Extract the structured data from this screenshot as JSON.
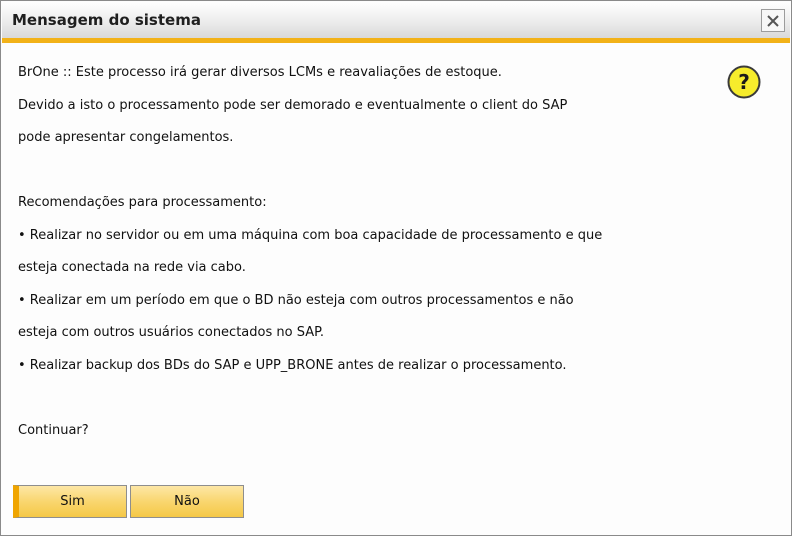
{
  "dialog": {
    "title": "Mensagem do sistema",
    "close_icon": "close-icon",
    "question_icon": "question-icon",
    "accent_color": "#f2b219",
    "lines": [
      "BrOne :: Este processo irá gerar diversos LCMs e reavaliações de estoque.",
      "Devido a isto o processamento pode ser demorado e eventualmente o client do SAP",
      "pode apresentar congelamentos.",
      "",
      "Recomendações para processamento:",
      "• Realizar no servidor ou em uma máquina com boa capacidade de processamento e que",
      "esteja conectada na rede via cabo.",
      "• Realizar em um período em que o BD não esteja com outros processamentos e não",
      "esteja com outros usuários conectados no SAP.",
      "• Realizar backup dos BDs do SAP e UPP_BRONE antes de realizar o processamento.",
      "",
      "Continuar?"
    ],
    "buttons": {
      "yes_label": "Sim",
      "no_label": "Não"
    }
  }
}
